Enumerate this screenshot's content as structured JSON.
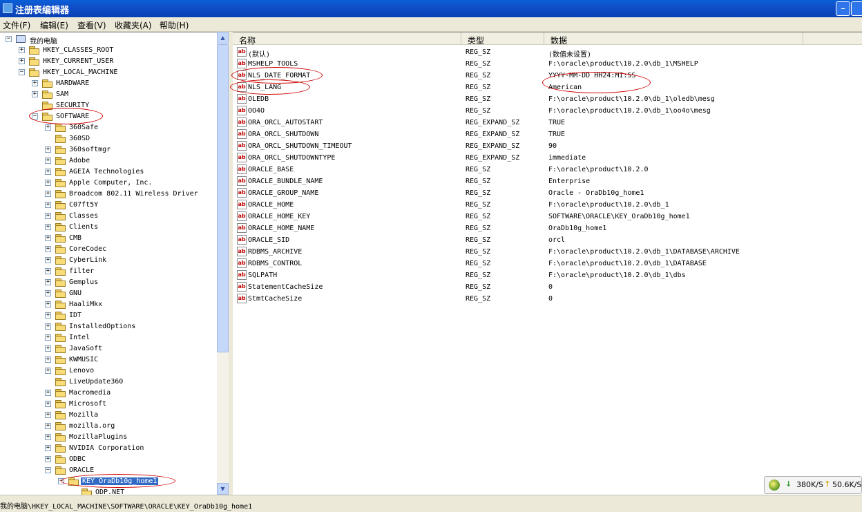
{
  "window": {
    "title": "注册表编辑器"
  },
  "menu": [
    {
      "label": "文件(F)"
    },
    {
      "label": "编辑(E)"
    },
    {
      "label": "查看(V)"
    },
    {
      "label": "收藏夹(A)"
    },
    {
      "label": "帮助(H)"
    }
  ],
  "tree": {
    "root": "我的电脑",
    "hkeys": [
      "HKEY_CLASSES_ROOT",
      "HKEY_CURRENT_USER",
      "HKEY_LOCAL_MACHINE"
    ],
    "hklm": [
      "HARDWARE",
      "SAM",
      "SECURITY",
      "SOFTWARE"
    ],
    "software": [
      "360Safe",
      "360SD",
      "360softmgr",
      "Adobe",
      "AGEIA Technologies",
      "Apple Computer, Inc.",
      "Broadcom 802.11 Wireless Driver",
      "C07ft5Y",
      "Classes",
      "Clients",
      "CMB",
      "CoreCodec",
      "CyberLink",
      "filter",
      "Gemplus",
      "GNU",
      "HaaliMkx",
      "IDT",
      "InstalledOptions",
      "Intel",
      "JavaSoft",
      "KWMUSIC",
      "Lenovo",
      "LiveUpdate360",
      "Macromedia",
      "Microsoft",
      "Mozilla",
      "mozilla.org",
      "MozillaPlugins",
      "NVIDIA Corporation",
      "ODBC",
      "ORACLE"
    ],
    "oracle": [
      "KEY_OraDb10g_home1"
    ],
    "key": [
      "ODP.NET"
    ]
  },
  "list": {
    "headers": [
      "名称",
      "类型",
      "数据"
    ],
    "rows": [
      {
        "name": "(默认)",
        "type": "REG_SZ",
        "data": "(数值未设置)"
      },
      {
        "name": "MSHELP_TOOLS",
        "type": "REG_SZ",
        "data": "F:\\oracle\\product\\10.2.0\\db_1\\MSHELP"
      },
      {
        "name": "NLS_DATE_FORMAT",
        "type": "REG_SZ",
        "data": "YYYY-MM-DD HH24:MI:SS"
      },
      {
        "name": "NLS_LANG",
        "type": "REG_SZ",
        "data": "American"
      },
      {
        "name": "OLEDB",
        "type": "REG_SZ",
        "data": "F:\\oracle\\product\\10.2.0\\db_1\\oledb\\mesg"
      },
      {
        "name": "OO4O",
        "type": "REG_SZ",
        "data": "F:\\oracle\\product\\10.2.0\\db_1\\oo4o\\mesg"
      },
      {
        "name": "ORA_ORCL_AUTOSTART",
        "type": "REG_EXPAND_SZ",
        "data": "TRUE"
      },
      {
        "name": "ORA_ORCL_SHUTDOWN",
        "type": "REG_EXPAND_SZ",
        "data": "TRUE"
      },
      {
        "name": "ORA_ORCL_SHUTDOWN_TIMEOUT",
        "type": "REG_EXPAND_SZ",
        "data": "90"
      },
      {
        "name": "ORA_ORCL_SHUTDOWNTYPE",
        "type": "REG_EXPAND_SZ",
        "data": "immediate"
      },
      {
        "name": "ORACLE_BASE",
        "type": "REG_SZ",
        "data": "F:\\oracle\\product\\10.2.0"
      },
      {
        "name": "ORACLE_BUNDLE_NAME",
        "type": "REG_SZ",
        "data": "Enterprise"
      },
      {
        "name": "ORACLE_GROUP_NAME",
        "type": "REG_SZ",
        "data": "Oracle - OraDb10g_home1"
      },
      {
        "name": "ORACLE_HOME",
        "type": "REG_SZ",
        "data": "F:\\oracle\\product\\10.2.0\\db_1"
      },
      {
        "name": "ORACLE_HOME_KEY",
        "type": "REG_SZ",
        "data": "SOFTWARE\\ORACLE\\KEY_OraDb10g_home1"
      },
      {
        "name": "ORACLE_HOME_NAME",
        "type": "REG_SZ",
        "data": "OraDb10g_home1"
      },
      {
        "name": "ORACLE_SID",
        "type": "REG_SZ",
        "data": "orcl"
      },
      {
        "name": "RDBMS_ARCHIVE",
        "type": "REG_SZ",
        "data": "F:\\oracle\\product\\10.2.0\\db_1\\DATABASE\\ARCHIVE"
      },
      {
        "name": "RDBMS_CONTROL",
        "type": "REG_SZ",
        "data": "F:\\oracle\\product\\10.2.0\\db_1\\DATABASE"
      },
      {
        "name": "SQLPATH",
        "type": "REG_SZ",
        "data": "F:\\oracle\\product\\10.2.0\\db_1\\dbs"
      },
      {
        "name": "StatementCacheSize",
        "type": "REG_SZ",
        "data": "0"
      },
      {
        "name": "StmtCacheSize",
        "type": "REG_SZ",
        "data": "0"
      }
    ]
  },
  "status": {
    "path": "我的电脑\\HKEY_LOCAL_MACHINE\\SOFTWARE\\ORACLE\\KEY_OraDb10g_home1"
  },
  "netspeed": {
    "down": "380K/S",
    "up": "50.6K/S"
  },
  "icons": {
    "value_icon": "ab",
    "down_arrow": "↓",
    "up_arrow": "↑"
  }
}
